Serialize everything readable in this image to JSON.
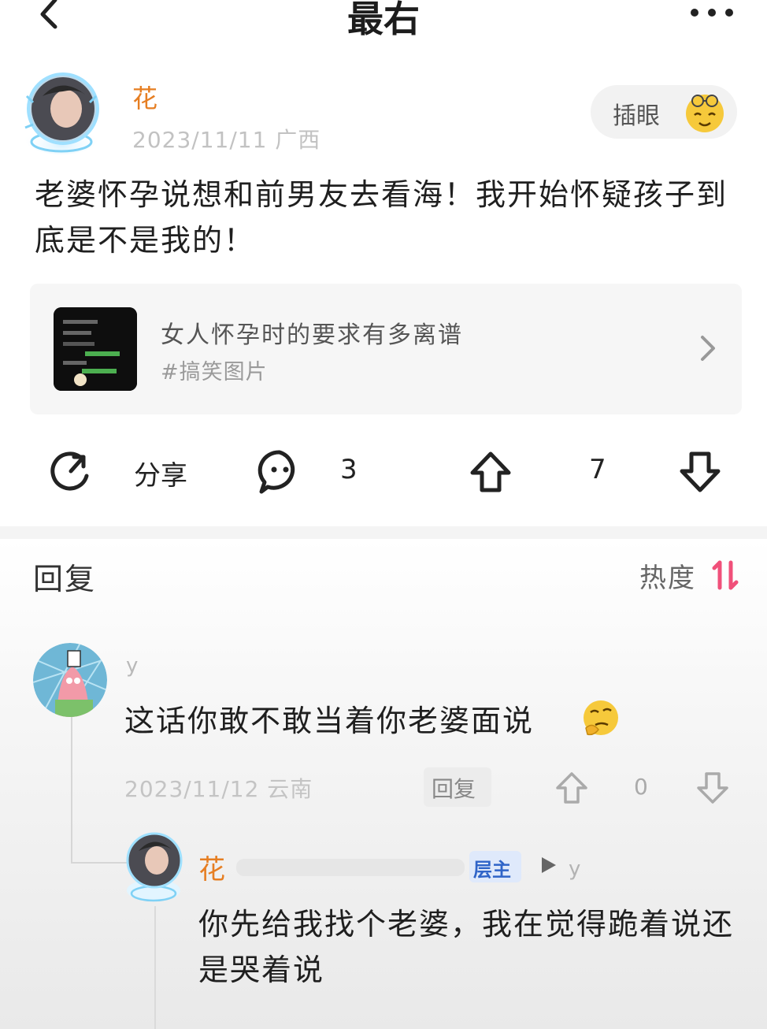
{
  "header": {
    "title": "最右"
  },
  "post": {
    "author": "花",
    "date": "2023/11/11",
    "location": "广西",
    "chayan_label": "插眼",
    "text": "老婆怀孕说想和前男友去看海！我开始怀疑孩子到底是不是我的！",
    "link_card": {
      "title": "女人怀孕时的要求有多离谱",
      "tag": "#搞笑图片"
    },
    "actions": {
      "share_label": "分享",
      "comment_count": "3",
      "like_count": "7"
    }
  },
  "replies": {
    "heading": "回复",
    "sort_label": "热度",
    "items": [
      {
        "author": "y",
        "text": "这话你敢不敢当着你老婆面说",
        "date": "2023/11/12",
        "location": "云南",
        "reply_label": "回复",
        "like_count": "0",
        "sub_replies": [
          {
            "author": "花",
            "badge": "层主",
            "reply_to": "y",
            "text": "你先给我找个老婆，我在觉得跪着说还是哭着说"
          }
        ]
      }
    ]
  },
  "colors": {
    "accent_orange": "#e67e22",
    "sort_icon_pink": "#f0507a",
    "badge_blue": "#2f64c8"
  },
  "icons": [
    "back-icon",
    "more-icon",
    "share-icon",
    "comment-icon",
    "upvote-icon",
    "downvote-icon",
    "chevron-right-icon",
    "sort-icon",
    "reply-arrow-icon"
  ]
}
